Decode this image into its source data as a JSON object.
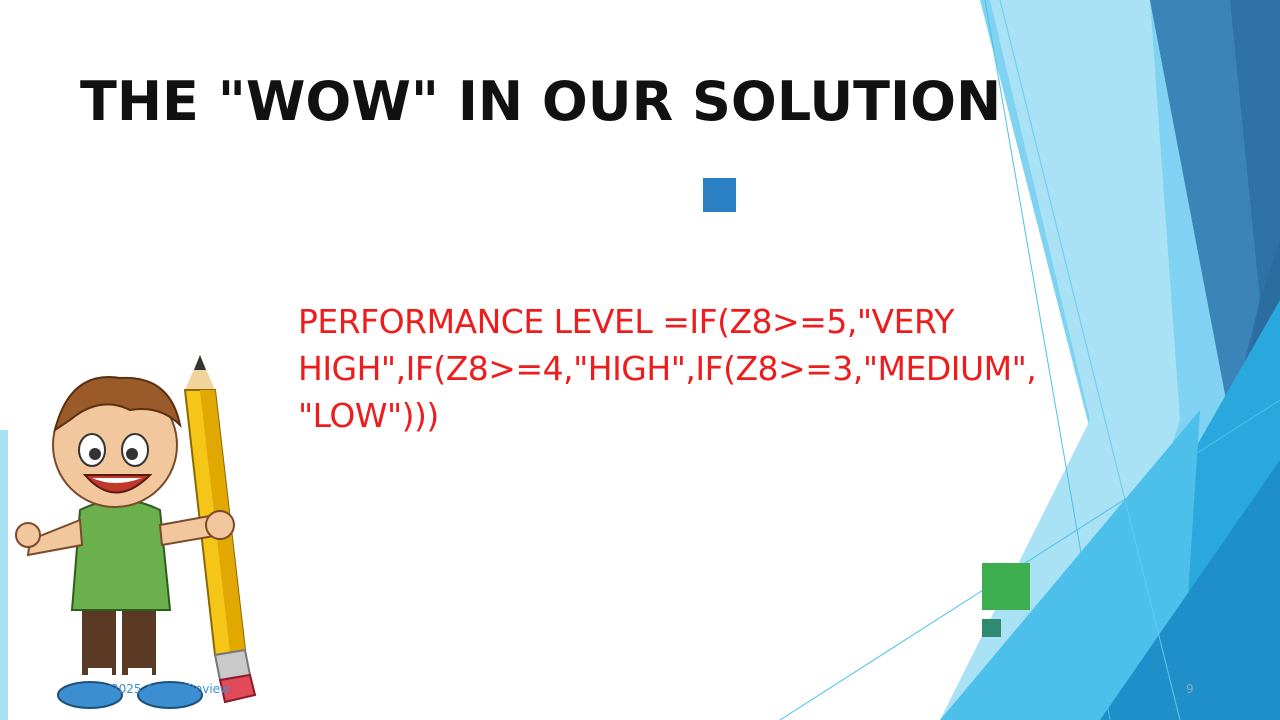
{
  "slide": {
    "title": "THE \"WOW\" IN OUR SOLUTION",
    "formula": "PERFORMANCE LEVEL =IF(Z8>=5,\"VERY HIGH\",IF(Z8>=4,\"HIGH\",IF(Z8>=3,\"MEDIUM\", \"LOW\")))",
    "footer_date": "7/23/2025 AnnualReview",
    "page_number": "9"
  },
  "colors": {
    "title": "#111111",
    "formula": "#ee1c1c",
    "accent_blue": "#2b7fc3",
    "accent_green": "#3cae4f",
    "accent_teal": "#2e8b6e",
    "footer": "#3b8fd0",
    "page_number": "#8aa8c0"
  },
  "illustration": {
    "subject": "cartoon boy holding a giant pencil giving thumbs up"
  }
}
